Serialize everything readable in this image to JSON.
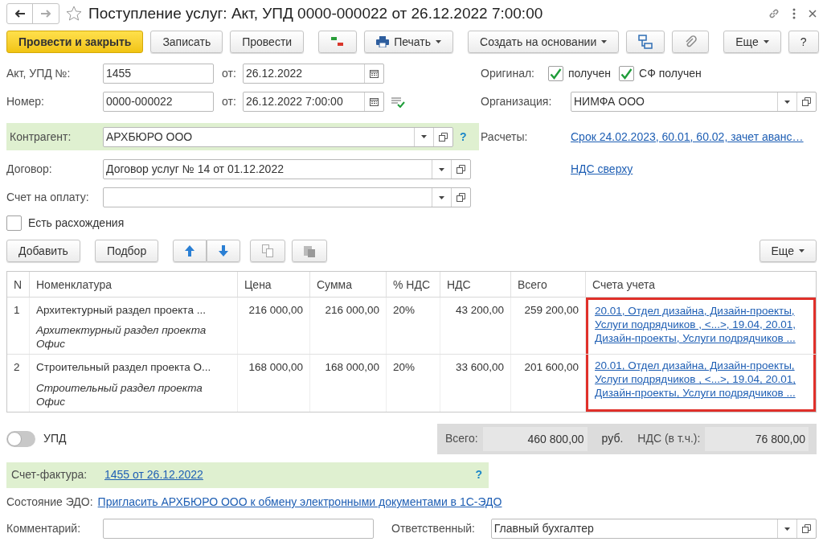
{
  "window": {
    "title": "Поступление услуг: Акт, УПД 0000-000022 от 26.12.2022 7:00:00",
    "favorite": false
  },
  "toolbar": [
    {
      "kind": "primary",
      "label": "Провести и закрыть"
    },
    {
      "kind": "plain",
      "label": "Записать"
    },
    {
      "kind": "plain",
      "label": "Провести"
    },
    {
      "kind": "dtkt"
    },
    {
      "kind": "print",
      "label": "Печать"
    },
    {
      "kind": "menu",
      "label": "Создать на основании"
    },
    {
      "kind": "structure"
    },
    {
      "kind": "attach"
    },
    {
      "kind": "menu",
      "label": "Еще"
    },
    {
      "kind": "plain",
      "label": "?"
    }
  ],
  "header": {
    "act_label": "Акт, УПД №:",
    "act_number": "1455",
    "act_from_label": "от:",
    "act_date": "26.12.2022",
    "number_label": "Номер:",
    "number": "0000-000022",
    "number_from_label": "от:",
    "number_date": "26.12.2022  7:00:00",
    "original_label": "Оригинал:",
    "checks": [
      {
        "label": "получен",
        "checked": true
      },
      {
        "label": "СФ получен",
        "checked": true
      }
    ],
    "org_label": "Организация:",
    "org": "НИМФА ООО",
    "counterparty_label": "Контрагент:",
    "counterparty": "АРХБЮРО ООО",
    "help": "?",
    "settlements_label": "Расчеты:",
    "settlements_link": "Срок 24.02.2023, 60.01, 60.02, зачет аванс…",
    "vat_link": "НДС сверху",
    "contract_label": "Договор:",
    "contract": "Договор услуг № 14 от 01.12.2022",
    "invoice_label": "Счет на оплату:",
    "discrepancy": {
      "label": "Есть расхождения",
      "checked": false
    }
  },
  "table_toolbar": {
    "add": "Добавить",
    "pick": "Подбор",
    "more": "Еще"
  },
  "table": {
    "columns": [
      {
        "label": "N"
      },
      {
        "label": "Номенклатура"
      },
      {
        "label": "Цена"
      },
      {
        "label": "Сумма"
      },
      {
        "label": "% НДС"
      },
      {
        "label": "НДС"
      },
      {
        "label": "Всего"
      },
      {
        "label": "Счета учета",
        "highlighted": true
      }
    ],
    "rows": [
      {
        "n": "1",
        "name": "Архитектурный раздел проекта ...",
        "description": "Архитектурный раздел проекта Офис",
        "price": "216 000,00",
        "sum": "216 000,00",
        "rate": "20%",
        "vat": "43 200,00",
        "total": "259 200,00",
        "accounts": "20.01, Отдел дизайна, Дизайн-проекты, Услуги подрядчиков , <...>, 19.04, 20.01, Дизайн-проекты, Услуги подрядчиков ..."
      },
      {
        "n": "2",
        "name": "Строительный раздел проекта О...",
        "description": "Строительный раздел проекта Офис",
        "price": "168 000,00",
        "sum": "168 000,00",
        "rate": "20%",
        "vat": "33 600,00",
        "total": "201 600,00",
        "accounts": "20.01, Отдел дизайна, Дизайн-проекты, Услуги подрядчиков , <...>, 19.04, 20.01, Дизайн-проекты, Услуги подрядчиков ..."
      }
    ]
  },
  "upd": {
    "label": "УПД",
    "on": false
  },
  "totals": {
    "total_label": "Всего:",
    "total": "460 800,00",
    "currency": "руб.",
    "vat_label": "НДС (в т.ч.):",
    "vat": "76 800,00"
  },
  "invoice": {
    "label": "Счет-фактура:",
    "link": "1455 от 26.12.2022",
    "help": "?"
  },
  "edo": {
    "label": "Состояние ЭДО:",
    "link": "Пригласить АРХБЮРО ООО к обмену электронными документами в 1С-ЭДО"
  },
  "footer": {
    "comment_label": "Комментарий:",
    "responsible_label": "Ответственный:",
    "responsible": "Главный бухгалтер"
  }
}
